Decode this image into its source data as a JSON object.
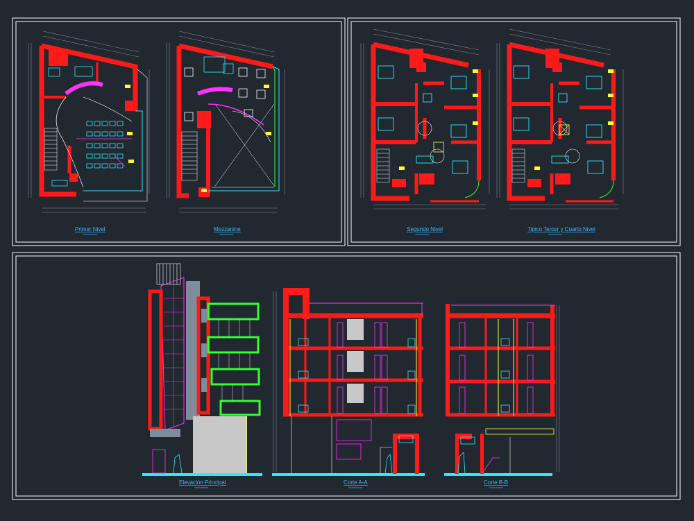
{
  "colors": {
    "background": "#212830",
    "frame": "#ffffff",
    "wall": "#ff1a1a",
    "furniture": "#33e6ff",
    "accent": "#ff33ff",
    "green": "#33ff33",
    "yellow": "#ffff33",
    "grey": "#c8c8c8",
    "dim": "#7f8c99",
    "label": "#39b6ff"
  },
  "drawing_titles": {
    "primer_nivel": "Primer Nivel",
    "mezzanine": "Mezzanine",
    "segundo_nivel": "Segundo Nivel",
    "tipico": "Tipico Tercer y Cuarto Nivel",
    "elevacion": "Elevación Principal",
    "corte_aa": "Corte A-A",
    "corte_bb": "Corte B-B"
  }
}
